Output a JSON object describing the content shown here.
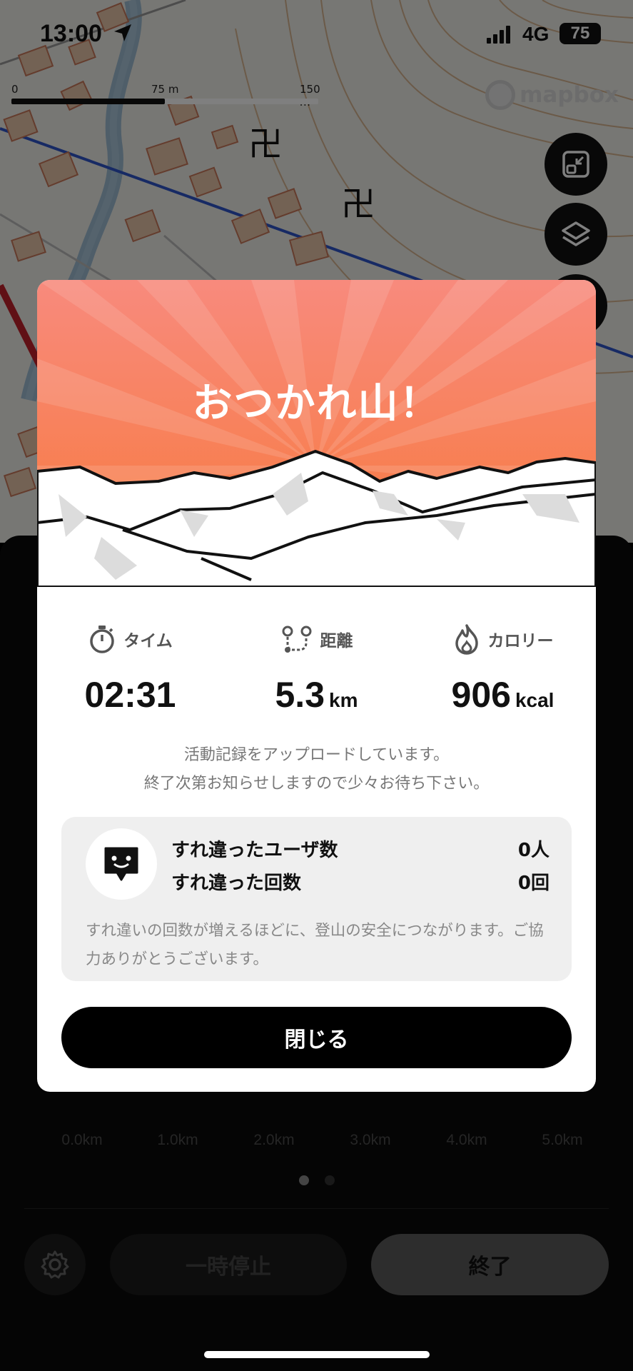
{
  "status_bar": {
    "time": "13:00",
    "network": "4G",
    "battery": "75"
  },
  "map": {
    "attribution": "mapbox",
    "scale_labels": [
      "0",
      "75 m",
      "150 m"
    ],
    "buttons": [
      "collapse-map-icon",
      "layers-icon",
      "search-icon"
    ]
  },
  "modal": {
    "title": "おつかれ山！",
    "stats": [
      {
        "label": "タイム",
        "value": "02:31",
        "unit": "",
        "icon": "stopwatch-icon"
      },
      {
        "label": "距離",
        "value": "5.3",
        "unit": "km",
        "icon": "route-icon"
      },
      {
        "label": "カロリー",
        "value": "906",
        "unit": "kcal",
        "icon": "flame-icon"
      }
    ],
    "upload_message_line1": "活動記録をアップロードしています。",
    "upload_message_line2": "終了次第お知らせしますので少々お待ち下さい。",
    "encounter": {
      "users_label": "すれ違ったユーザ数",
      "users_value": "0人",
      "count_label": "すれ違った回数",
      "count_value": "0回",
      "note": "すれ違いの回数が増えるほどに、登山の安全につながります。ご協力ありがとうございます。"
    },
    "close_label": "閉じる"
  },
  "panel": {
    "x_ticks": [
      "0.0km",
      "1.0km",
      "2.0km",
      "3.0km",
      "4.0km",
      "5.0km"
    ],
    "pause_label": "一時停止",
    "end_label": "終了",
    "colors": {
      "accent_top": "#f88a7d",
      "accent_bottom": "#f7793a"
    }
  }
}
